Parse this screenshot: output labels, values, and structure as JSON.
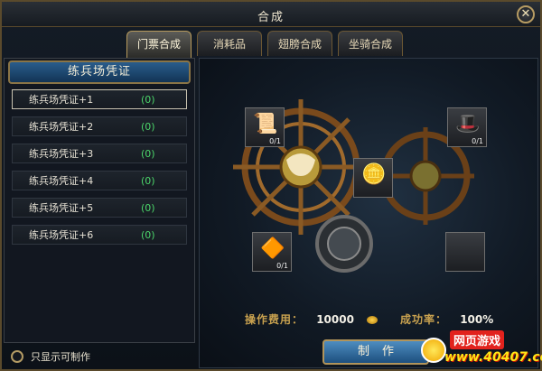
{
  "window": {
    "title": "合成",
    "close_label": "✕"
  },
  "tabs": [
    {
      "label": "门票合成",
      "active": true
    },
    {
      "label": "消耗品",
      "active": false
    },
    {
      "label": "翅膀合成",
      "active": false
    },
    {
      "label": "坐骑合成",
      "active": false
    }
  ],
  "list": {
    "header": "练兵场凭证",
    "items": [
      {
        "name": "练兵场凭证+1",
        "count": "(0)"
      },
      {
        "name": "练兵场凭证+2",
        "count": "(0)"
      },
      {
        "name": "练兵场凭证+3",
        "count": "(0)"
      },
      {
        "name": "练兵场凭证+4",
        "count": "(0)"
      },
      {
        "name": "练兵场凭证+5",
        "count": "(0)"
      },
      {
        "name": "练兵场凭证+6",
        "count": "(0)"
      }
    ]
  },
  "filter": {
    "label": "只显示可制作"
  },
  "slots": {
    "top_left": {
      "qty": "0/1",
      "icon": "scroll-icon"
    },
    "top_right": {
      "qty": "0/1",
      "icon": "pirate-hat-icon"
    },
    "bottom_left": {
      "qty": "0/1",
      "icon": "crystal-icon"
    },
    "result": {
      "icon": "pirate-coin-icon"
    },
    "bottom_right": {
      "qty": "",
      "icon": "empty-slot"
    }
  },
  "cost": {
    "label": "操作费用：",
    "value": "10000",
    "icon": "coin-icon"
  },
  "rate": {
    "label": "成功率：",
    "value": "100%"
  },
  "make_button": {
    "label": "制作"
  },
  "watermark": {
    "top": "网页游戏",
    "bottom": "www.40407.com"
  },
  "colors": {
    "accent_gold": "#c8a14f",
    "count_green": "#4bd56a",
    "button_blue": "#2f6fa5"
  }
}
